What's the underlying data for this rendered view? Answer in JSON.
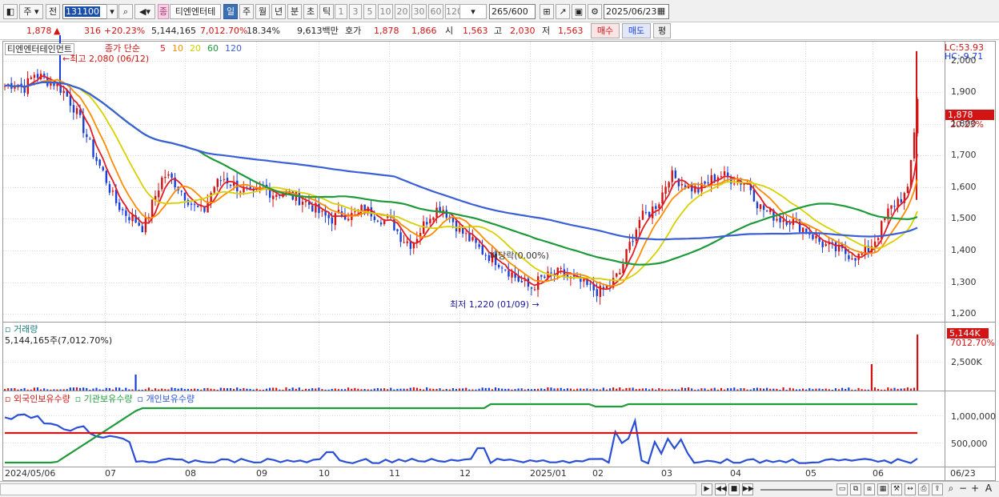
{
  "toolbar": {
    "market_label": "주",
    "prev_label": "전",
    "code": "131100",
    "stock_name": "티엔엔터테",
    "stock_tag": "종",
    "period_buttons": [
      "일",
      "주",
      "월",
      "년",
      "분",
      "초",
      "틱"
    ],
    "active_period": "일",
    "minute_buttons": [
      "1",
      "3",
      "5",
      "10",
      "20",
      "30",
      "60",
      "120"
    ],
    "count_display": "265",
    "count_total": "/600",
    "date": "2025/06/23"
  },
  "quote": {
    "price": "1,878",
    "change_arrow": "▲",
    "change": "316",
    "change_pct": "+20.23%",
    "volume": "5,144,165",
    "volume_ratio": "7,012.70%",
    "turnover": "18.34%",
    "trade_value": "9,613백만",
    "ask_label": "호가",
    "ask_price": "1,878",
    "bid_price": "1,866",
    "open_label": "시",
    "open": "1,563",
    "high_label": "고",
    "high": "2,030",
    "low_label": "저",
    "low": "1,563",
    "buy_button": "매수",
    "sell_button": "매도",
    "eval_button": "평"
  },
  "price_panel": {
    "stock_title": "티엔엔터테인먼트",
    "legend_type": "종가 단순",
    "ma_legend": [
      {
        "label": "5",
        "color": "#e51c23"
      },
      {
        "label": "10",
        "color": "#ff8c00"
      },
      {
        "label": "20",
        "color": "#d8d000"
      },
      {
        "label": "60",
        "color": "#1f9a3a"
      },
      {
        "label": "120",
        "color": "#3b5fd6"
      }
    ],
    "max_label": "최고 2,080 (06/12)",
    "min_label": "최저 1,220 (01/09)",
    "dividend_label": "배당락(0.00%)",
    "lc_label": "LC:53.93",
    "hc_label": "HC:-9.71",
    "current_price_tag": "1,878",
    "current_pct_tag": "20.23%",
    "y_ticks": [
      "2,000",
      "1,900",
      "1,800",
      "1,700",
      "1,600",
      "1,500",
      "1,400",
      "1,300",
      "1,200"
    ]
  },
  "volume_panel": {
    "title": "거래량",
    "value": "5,144,165주(7,012.70%)",
    "current_tag": "5,144K",
    "current_pct": "7012.70%",
    "y_tick": "2,500K"
  },
  "holdings_panel": {
    "series": [
      {
        "label": "외국인보유수량",
        "color": "#d21414"
      },
      {
        "label": "기관보유수량",
        "color": "#1f9a3a"
      },
      {
        "label": "개인보유수량",
        "color": "#2a4fd6"
      }
    ],
    "y_ticks": [
      "1,000,000",
      "500,000"
    ]
  },
  "x_axis": {
    "labels": [
      "2024/05/06",
      "07",
      "08",
      "09",
      "10",
      "11",
      "12",
      "2025/01",
      "02",
      "03",
      "04",
      "05",
      "06"
    ],
    "last_label": "06/23"
  },
  "chart_data": {
    "type": "candlestick",
    "title": "티엔엔터테인먼트",
    "ylim": [
      1180,
      2060
    ],
    "x_labels": [
      "2024/05/06",
      "07",
      "08",
      "09",
      "10",
      "11",
      "12",
      "2025/01",
      "02",
      "03",
      "04",
      "05",
      "06"
    ],
    "close_path": [
      1920,
      1930,
      1915,
      1960,
      1940,
      1930,
      1900,
      1850,
      1780,
      1700,
      1640,
      1560,
      1520,
      1500,
      1470,
      1560,
      1640,
      1620,
      1580,
      1540,
      1520,
      1600,
      1630,
      1610,
      1590,
      1570,
      1600,
      1580,
      1585,
      1570,
      1560,
      1540,
      1510,
      1500,
      1520,
      1510,
      1530,
      1520,
      1500,
      1490,
      1440,
      1420,
      1470,
      1520,
      1540,
      1500,
      1460,
      1430,
      1400,
      1380,
      1360,
      1330,
      1300,
      1280,
      1310,
      1320,
      1330,
      1310,
      1300,
      1280,
      1270,
      1290,
      1330,
      1420,
      1500,
      1520,
      1560,
      1640,
      1620,
      1600,
      1590,
      1620,
      1640,
      1630,
      1620,
      1610,
      1540,
      1520,
      1500,
      1500,
      1480,
      1460,
      1430,
      1410,
      1400,
      1390,
      1380,
      1400,
      1450,
      1520,
      1560,
      1580,
      1878
    ],
    "ma_series": [
      {
        "name": "5",
        "color": "#e51c23"
      },
      {
        "name": "10",
        "color": "#ff8c00"
      },
      {
        "name": "20",
        "color": "#d8d000"
      },
      {
        "name": "60",
        "color": "#1f9a3a"
      },
      {
        "name": "120",
        "color": "#3b5fd6"
      }
    ],
    "current_price": 1878,
    "high": 2080,
    "low": 1220,
    "volume_spike_indices": [
      18,
      88,
      92
    ],
    "volume_current": 5144165
  }
}
